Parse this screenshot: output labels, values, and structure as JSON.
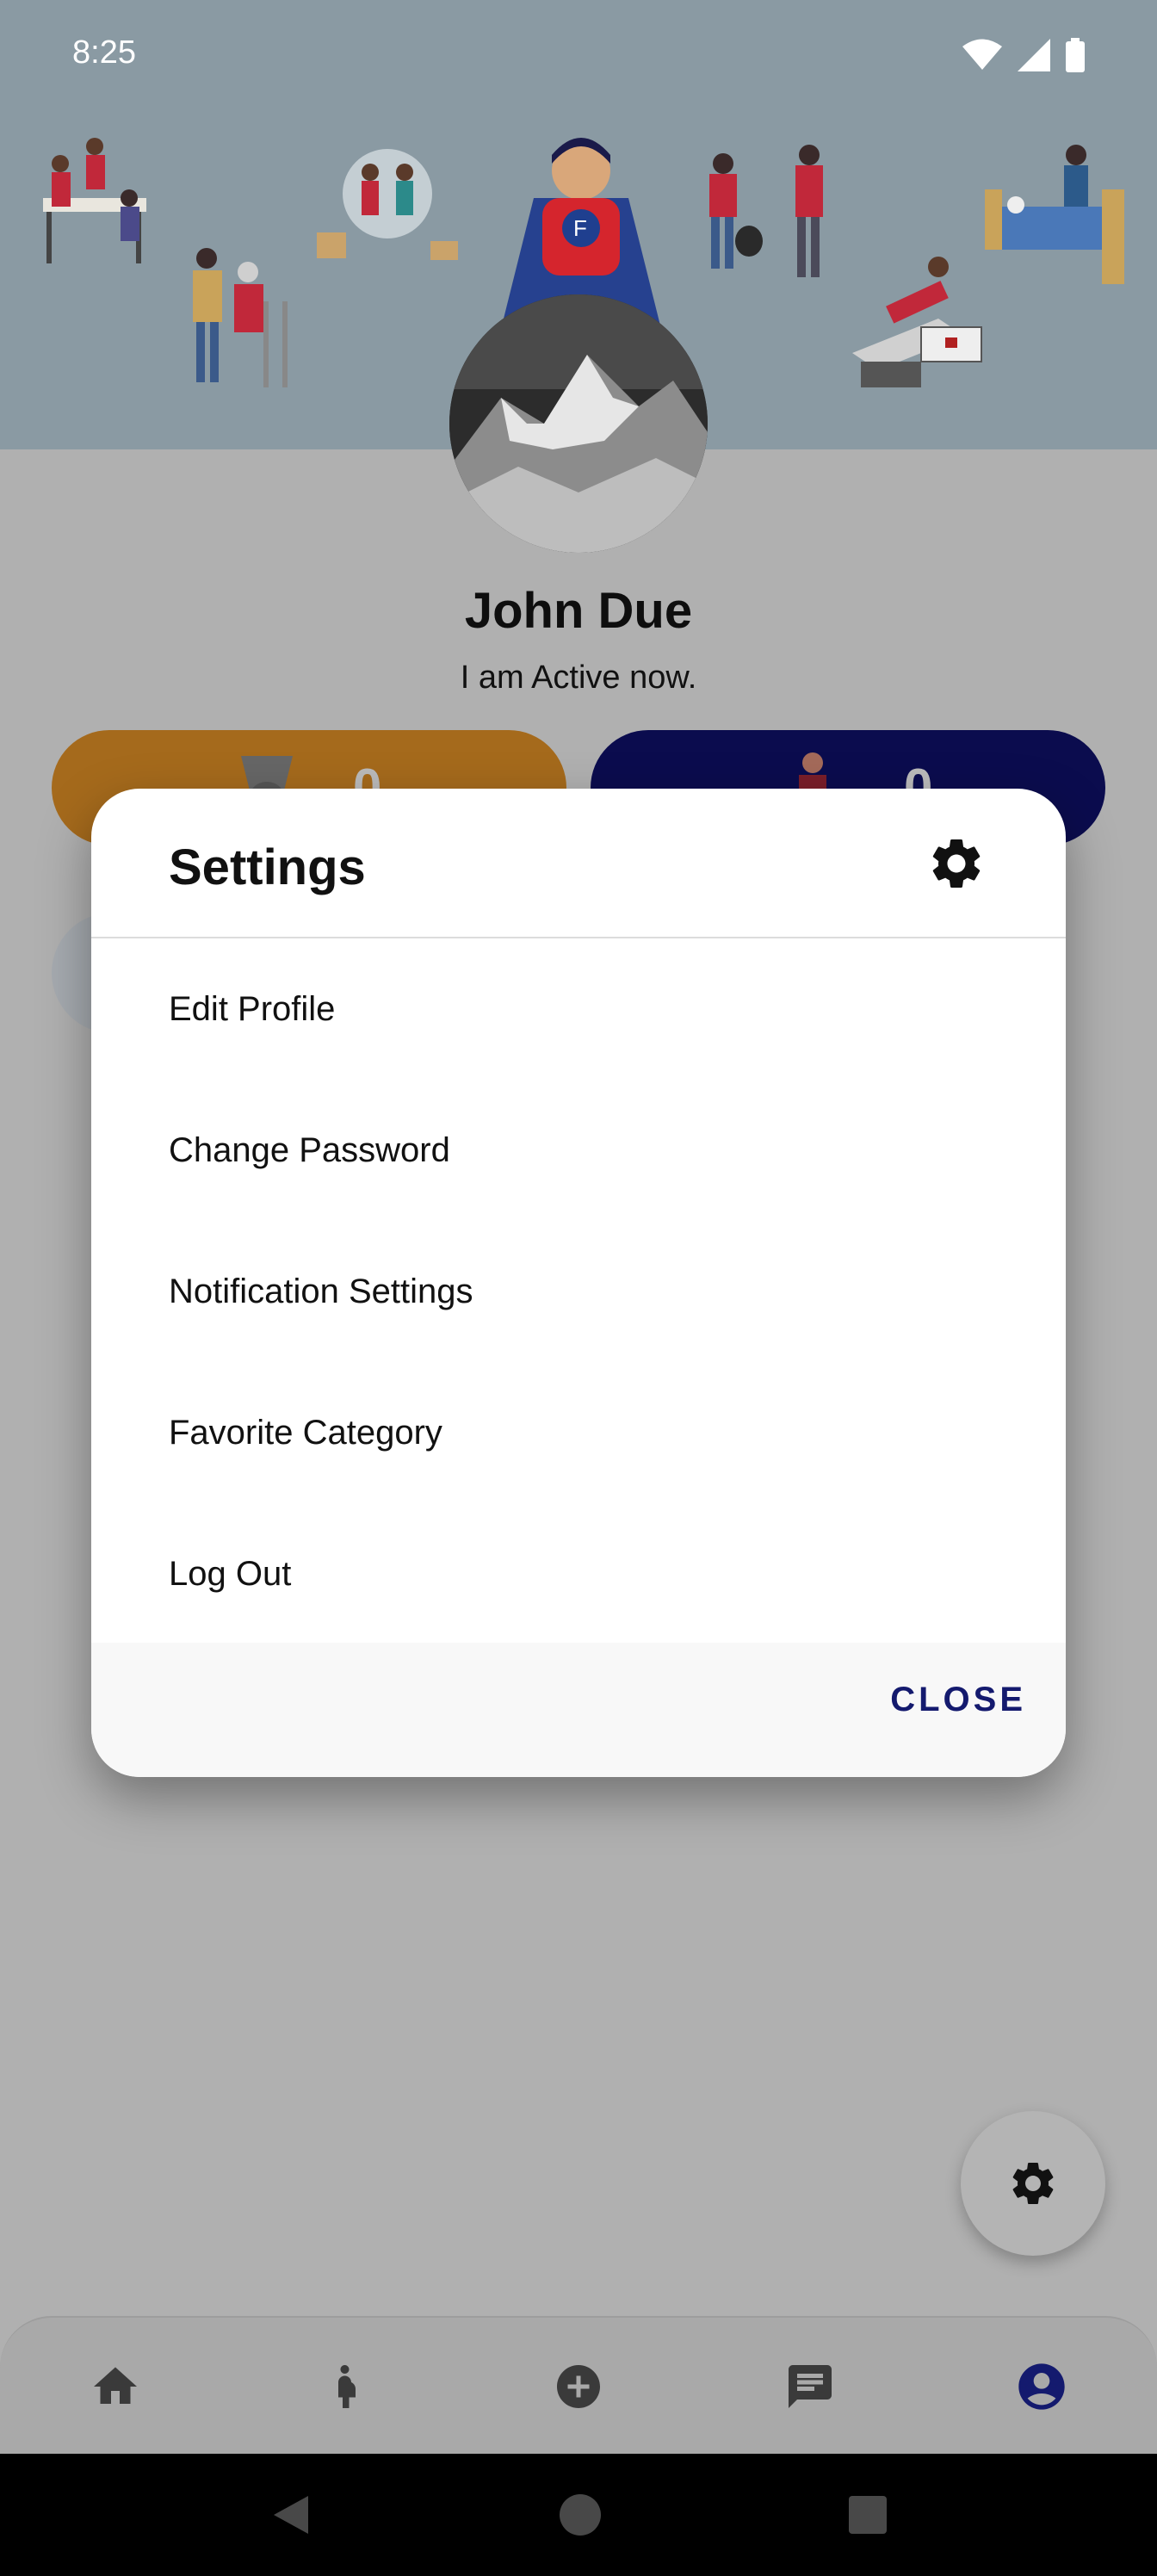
{
  "status_bar": {
    "time": "8:25"
  },
  "profile": {
    "name": "John Due",
    "status": "I am Active now.",
    "stat_left_value": "0",
    "stat_right_value": "0"
  },
  "dialog": {
    "title": "Settings",
    "items": [
      {
        "label": "Edit Profile"
      },
      {
        "label": "Change Password"
      },
      {
        "label": "Notification Settings"
      },
      {
        "label": "Favorite Category"
      },
      {
        "label": "Log Out"
      }
    ],
    "close_label": "CLOSE"
  },
  "bottom_nav": {
    "items": [
      "home-icon",
      "pregnant-person-icon",
      "add-circle-icon",
      "chat-icon",
      "account-icon"
    ],
    "active": "account-icon"
  },
  "colors": {
    "accent": "#141a6e",
    "orange_pill": "#ffa500",
    "navy_pill": "#161799",
    "header": "#8a9aa3"
  }
}
